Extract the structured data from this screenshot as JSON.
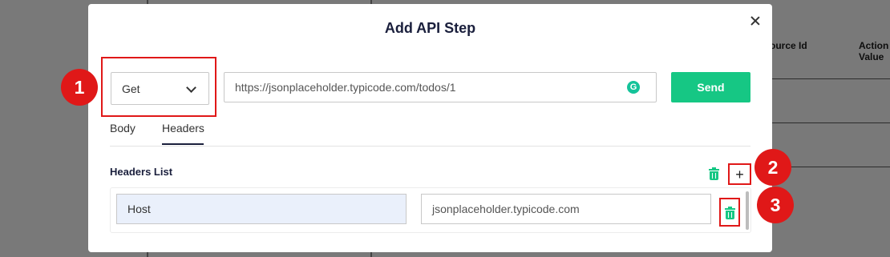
{
  "background": {
    "columns": [
      {
        "label": "ource Id"
      },
      {
        "label": "Action Value"
      }
    ]
  },
  "modal": {
    "title": "Add API Step",
    "close_icon": "close-icon"
  },
  "request": {
    "method": "Get",
    "url": "https://jsonplaceholder.typicode.com/todos/1",
    "send_label": "Send"
  },
  "tabs": [
    {
      "label": "Body",
      "active": false
    },
    {
      "label": "Headers",
      "active": true
    }
  ],
  "headers_section": {
    "title": "Headers List",
    "add_symbol": "+",
    "rows": [
      {
        "key": "Host",
        "value": "jsonplaceholder.typicode.com"
      }
    ]
  },
  "annotations": [
    {
      "number": "1"
    },
    {
      "number": "2"
    },
    {
      "number": "3"
    }
  ],
  "colors": {
    "accent_green": "#16c784",
    "annotation_red": "#e01818",
    "title_navy": "#1a1f3c"
  }
}
